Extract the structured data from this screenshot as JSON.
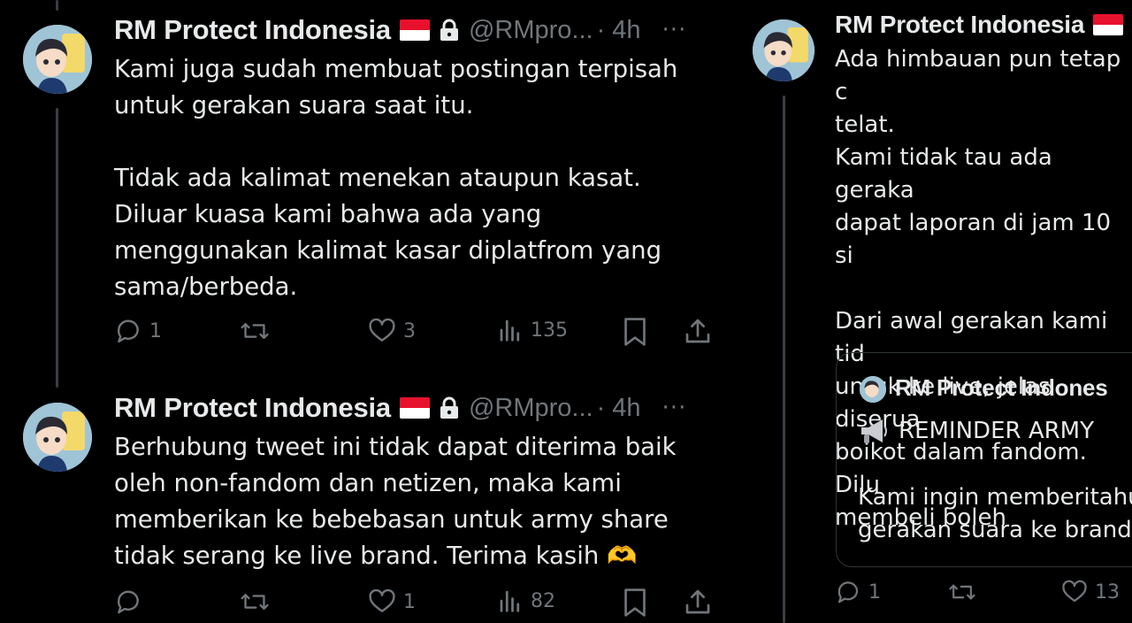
{
  "tweets": [
    {
      "author": "RM Protect Indonesia",
      "handle": "@RMpro...",
      "time": "· 4h",
      "more": "···",
      "text": "Kami juga sudah membuat postingan terpisah\nuntuk gerakan suara saat itu.\n\nTidak ada kalimat menekan ataupun kasat.\nDiluar kuasa kami bahwa ada yang\nmenggunakan kalimat kasar diplatfrom yang\nsama/berbeda.",
      "replies": "1",
      "reposts": "",
      "likes": "3",
      "views": "135"
    },
    {
      "author": "RM Protect Indonesia",
      "handle": "@RMpro...",
      "time": "· 4h",
      "more": "···",
      "text": "Berhubung tweet ini tidak dapat diterima baik\noleh non-fandom dan netizen, maka kami\nmemberikan ke bebebasan untuk army share\ntidak serang ke live brand. Terima kasih 🫶",
      "replies": "",
      "reposts": "",
      "likes": "1",
      "views": "82"
    }
  ],
  "right_tweet": {
    "author": "RM Protect Indonesia",
    "text": "Ada himbauan pun tetap c\ntelat.\nKami tidak tau ada geraka\ndapat laporan di jam 10 si\n\nDari awal gerakan kami tid\nuntuk ke live, jelas diserua\nboikot dalam fandom. Dilu\nmembeli boleh",
    "replies": "1",
    "likes": "13",
    "quote": {
      "author": "RM Protect Indones",
      "title": "REMINDER ARMY",
      "text": "Kami ingin memberitahu\ngerakan suara ke brand S"
    }
  },
  "colors": {
    "background": "#000000",
    "text": "#e7e9ea",
    "muted": "#71767b",
    "border": "#2f3336"
  },
  "icons": [
    "reply-icon",
    "repost-icon",
    "like-icon",
    "views-icon",
    "bookmark-icon",
    "share-icon",
    "lock-icon",
    "flag-icon",
    "megaphone-icon"
  ]
}
